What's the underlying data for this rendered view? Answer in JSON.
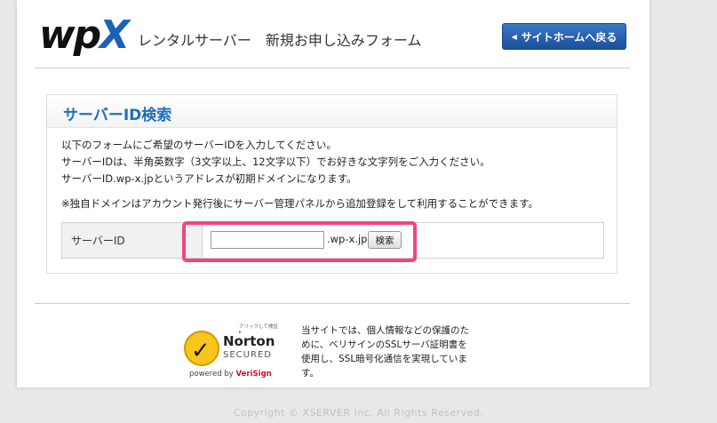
{
  "header": {
    "logo_main": "wp",
    "logo_accent": "X",
    "title_service": "レンタルサーバー",
    "title_form": "新規お申し込みフォーム",
    "home_button": "サイトホームへ戻る"
  },
  "search_box": {
    "title": "サーバーID検索",
    "desc_line1": "以下のフォームにご希望のサーバーIDを入力してください。",
    "desc_line2": "サーバーIDは、半角英数字（3文字以上、12文字以下）でお好きな文字列をご入力ください。",
    "desc_line3": "サーバーID.wp-x.jpというアドレスが初期ドメインになります。",
    "note": "※独自ドメインはアカウント発行後にサーバー管理パネルから追加登録をして利用することができます。",
    "field_label": "サーバーID",
    "input_value": "",
    "domain_suffix": ".wp-x.jp",
    "search_button": "検索"
  },
  "footer": {
    "seal_click": "クリックして検証 ▸",
    "seal_brand": "Norton",
    "seal_secured": "SECURED",
    "seal_powered": "powered by",
    "seal_verisign": "VeriSign",
    "ssl_line1": "当サイトでは、個人情報などの保護のた",
    "ssl_line2": "めに、ベリサインのSSLサーバ証明書を",
    "ssl_line3": "使用し、SSL暗号化通信を実現していま",
    "ssl_line4": "す。",
    "copyright": "Copyright © XSERVER Inc. All Rights Reserved."
  },
  "colors": {
    "brand_blue": "#1a62b8",
    "highlight_pink": "#f2457e",
    "title_blue": "#1f6fb8"
  }
}
